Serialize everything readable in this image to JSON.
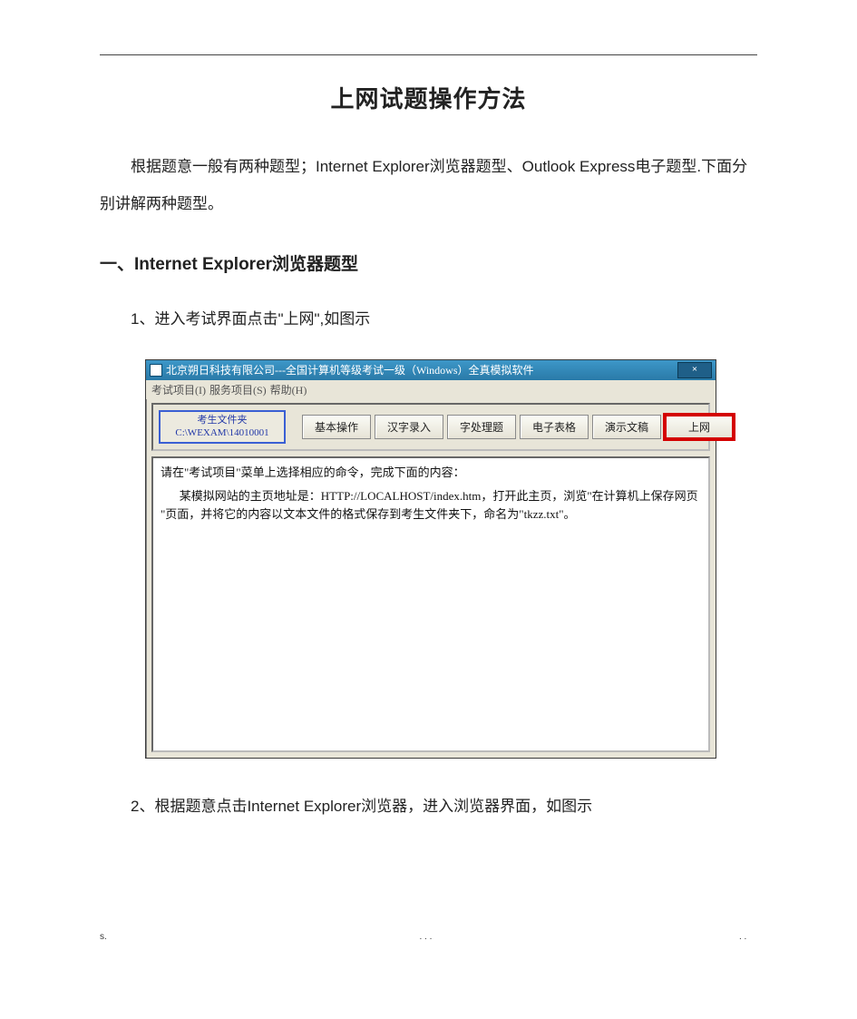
{
  "doc": {
    "title": "上网试题操作方法",
    "intro": "根据题意一般有两种题型；Internet Explorer浏览器题型、Outlook Express电子题型.下面分别讲解两种题型。",
    "h2": "一、Internet Explorer浏览器题型",
    "step1": "1、进入考试界面点击\"上网\",如图示",
    "step2": "2、根据题意点击Internet Explorer浏览器，进入浏览器界面，如图示",
    "footer_left": "s.",
    "footer_mid": ". . .",
    "footer_right": ". ."
  },
  "screenshot": {
    "title": "北京朔日科技有限公司---全国计算机等级考试一级（Windows）全真模拟软件",
    "close_label": "×",
    "menu": {
      "m1": "考试项目(I)",
      "m2": "服务项目(S)",
      "m3": "帮助(H)"
    },
    "folder": {
      "line1": "考生文件夹",
      "line2": "C:\\WEXAM\\14010001"
    },
    "buttons": {
      "b1": "基本操作",
      "b2": "汉字录入",
      "b3": "字处理题",
      "b4": "电子表格",
      "b5": "演示文稿",
      "b6": "上网"
    },
    "content": {
      "line1": "请在\"考试项目\"菜单上选择相应的命令，完成下面的内容：",
      "line2": "某模拟网站的主页地址是：HTTP://LOCALHOST/index.htm，打开此主页，浏览\"在计算机上保存网页 \"页面，并将它的内容以文本文件的格式保存到考生文件夹下，命名为\"tkzz.txt\"。"
    }
  }
}
